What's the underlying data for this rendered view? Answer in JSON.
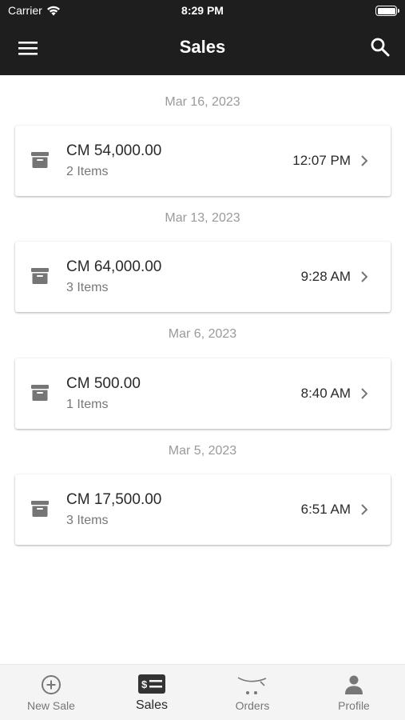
{
  "status_bar": {
    "carrier": "Carrier",
    "time": "8:29 PM"
  },
  "header": {
    "title": "Sales",
    "menu_icon": "hamburger-menu-icon",
    "search_icon": "search-icon"
  },
  "days": [
    {
      "date": "Mar 16, 2023",
      "sale": {
        "amount": "CM 54,000.00",
        "items": "2 Items",
        "time": "12:07 PM"
      }
    },
    {
      "date": "Mar 13, 2023",
      "sale": {
        "amount": "CM 64,000.00",
        "items": "3 Items",
        "time": "9:28 AM"
      }
    },
    {
      "date": "Mar 6, 2023",
      "sale": {
        "amount": "CM 500.00",
        "items": "1 Items",
        "time": "8:40 AM"
      }
    },
    {
      "date": "Mar 5, 2023",
      "sale": {
        "amount": "CM 17,500.00",
        "items": "3 Items",
        "time": "6:51 AM"
      }
    }
  ],
  "bottom_nav": [
    {
      "label": "New Sale",
      "icon": "add-circle-icon"
    },
    {
      "label": "Sales",
      "icon": "sales-receipt-icon",
      "active": true
    },
    {
      "label": "Orders",
      "icon": "cart-icon"
    },
    {
      "label": "Profile",
      "icon": "person-icon"
    }
  ],
  "colors": {
    "header_bg": "#1e1e1e",
    "icon_gray": "#757575",
    "muted_text": "#9a9a9a"
  }
}
